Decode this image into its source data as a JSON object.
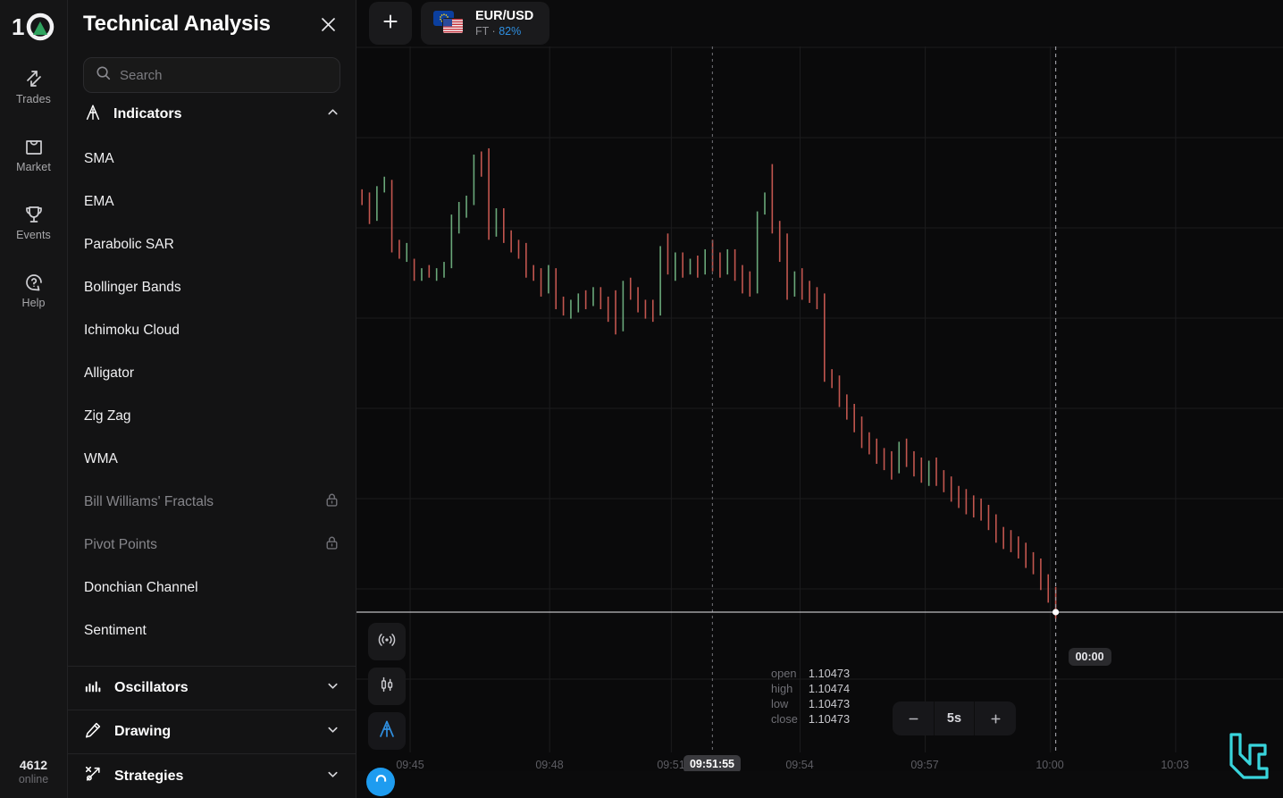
{
  "rail": {
    "logo": "1O-logo",
    "items": [
      {
        "label": "Trades",
        "icon": "trades-arrows-icon"
      },
      {
        "label": "Market",
        "icon": "market-bag-icon"
      },
      {
        "label": "Events",
        "icon": "events-trophy-icon"
      },
      {
        "label": "Help",
        "icon": "help-question-icon"
      }
    ],
    "online_count": "4612",
    "online_label": "online"
  },
  "panel": {
    "title": "Technical Analysis",
    "close_icon": "close-icon",
    "search": {
      "placeholder": "Search",
      "value": "",
      "icon": "search-icon"
    },
    "indicators_group": {
      "label": "Indicators",
      "icon": "indicators-icon",
      "expanded": true,
      "chevron": "chevron-up-icon",
      "items": [
        {
          "name": "SMA",
          "locked": false
        },
        {
          "name": "EMA",
          "locked": false
        },
        {
          "name": "Parabolic SAR",
          "locked": false
        },
        {
          "name": "Bollinger Bands",
          "locked": false
        },
        {
          "name": "Ichimoku Cloud",
          "locked": false
        },
        {
          "name": "Alligator",
          "locked": false
        },
        {
          "name": "Zig Zag",
          "locked": false
        },
        {
          "name": "WMA",
          "locked": false
        },
        {
          "name": "Bill Williams' Fractals",
          "locked": true
        },
        {
          "name": "Pivot Points",
          "locked": true
        },
        {
          "name": "Donchian Channel",
          "locked": false
        },
        {
          "name": "Sentiment",
          "locked": false
        }
      ]
    },
    "categories": [
      {
        "label": "Oscillators",
        "icon": "oscillators-bars-icon",
        "chevron": "chevron-down-icon"
      },
      {
        "label": "Drawing",
        "icon": "drawing-pencil-icon",
        "chevron": "chevron-down-icon"
      },
      {
        "label": "Strategies",
        "icon": "strategies-icon",
        "chevron": "chevron-down-icon"
      }
    ]
  },
  "topbar": {
    "add_label": "+",
    "add_icon": "plus-icon",
    "asset": {
      "name": "EUR/USD",
      "type": "FT",
      "separator": "·",
      "payout": "82%",
      "flag_left": "eu-flag-icon",
      "flag_right": "us-flag-icon"
    }
  },
  "chart": {
    "tools": [
      {
        "icon": "signal-broadcast-icon",
        "active": false
      },
      {
        "icon": "candlestick-chart-icon",
        "active": false
      },
      {
        "icon": "indicators-icon",
        "active": true
      }
    ],
    "ohlc": [
      {
        "key": "open",
        "value": "1.10473"
      },
      {
        "key": "high",
        "value": "1.10474"
      },
      {
        "key": "low",
        "value": "1.10473"
      },
      {
        "key": "close",
        "value": "1.10473"
      }
    ],
    "timeframe": {
      "minus": "−",
      "value": "5s",
      "plus": "+"
    },
    "countdown": "00:00",
    "current_time": "09:51:55",
    "time_labels": [
      "09:45",
      "09:48",
      "09:51",
      "09:54",
      "09:57",
      "10:00",
      "10:03"
    ],
    "watermark": "LC-logo"
  },
  "colors": {
    "bull": "#6aa87a",
    "bear": "#c2564f",
    "accent_blue": "#2f8fe0",
    "brand_green": "#2fa35f",
    "watermark_cyan": "#3ce0e8",
    "grid": "#1c1c1e",
    "background": "#0a0a0b"
  },
  "chart_data": {
    "type": "candlestick",
    "title": "EUR/USD",
    "xlabel": "",
    "ylabel": "",
    "interval": "5s",
    "grid": true,
    "x_ticks": [
      "09:45",
      "09:48",
      "09:51",
      "09:54",
      "09:57",
      "10:00",
      "10:03"
    ],
    "last_price": 1.10473,
    "ohlc_current": {
      "open": 1.10473,
      "high": 1.10474,
      "low": 1.10473,
      "close": 1.10473
    },
    "candles": [
      [
        1.1053,
        1.10532,
        1.10527,
        1.10529
      ],
      [
        1.10529,
        1.10531,
        1.10521,
        1.10523
      ],
      [
        1.10523,
        1.10533,
        1.10522,
        1.10532
      ],
      [
        1.10532,
        1.10536,
        1.10531,
        1.10534
      ],
      [
        1.10534,
        1.10535,
        1.10512,
        1.10514
      ],
      [
        1.10514,
        1.10516,
        1.1051,
        1.10512
      ],
      [
        1.10512,
        1.10515,
        1.10509,
        1.10514
      ],
      [
        1.10509,
        1.1051,
        1.10503,
        1.10505
      ],
      [
        1.10505,
        1.10507,
        1.10503,
        1.10506
      ],
      [
        1.10506,
        1.10508,
        1.10504,
        1.10505
      ],
      [
        1.10505,
        1.10507,
        1.10503,
        1.10506
      ],
      [
        1.10506,
        1.10509,
        1.10504,
        1.10508
      ],
      [
        1.10508,
        1.10524,
        1.10507,
        1.10522
      ],
      [
        1.10522,
        1.10528,
        1.10518,
        1.10526
      ],
      [
        1.10526,
        1.1053,
        1.10523,
        1.10528
      ],
      [
        1.10528,
        1.10543,
        1.10527,
        1.10541
      ],
      [
        1.10541,
        1.10544,
        1.10536,
        1.10539
      ],
      [
        1.10539,
        1.10545,
        1.10516,
        1.10519
      ],
      [
        1.10519,
        1.10526,
        1.10517,
        1.10524
      ],
      [
        1.10524,
        1.10526,
        1.10515,
        1.10517
      ],
      [
        1.10517,
        1.10519,
        1.10512,
        1.10514
      ],
      [
        1.10514,
        1.10516,
        1.1051,
        1.10513
      ],
      [
        1.10513,
        1.10515,
        1.10504,
        1.10506
      ],
      [
        1.10506,
        1.10508,
        1.10503,
        1.10505
      ],
      [
        1.10505,
        1.10507,
        1.10498,
        1.105
      ],
      [
        1.105,
        1.10508,
        1.10499,
        1.10506
      ],
      [
        1.10506,
        1.10507,
        1.10494,
        1.10496
      ],
      [
        1.10496,
        1.10498,
        1.10492,
        1.10494
      ],
      [
        1.10494,
        1.10497,
        1.10491,
        1.10495
      ],
      [
        1.10495,
        1.10499,
        1.10493,
        1.10497
      ],
      [
        1.10497,
        1.105,
        1.10494,
        1.10496
      ],
      [
        1.10496,
        1.10501,
        1.10495,
        1.10499
      ],
      [
        1.10499,
        1.10501,
        1.10494,
        1.10496
      ],
      [
        1.10496,
        1.10498,
        1.1049,
        1.10492
      ],
      [
        1.10492,
        1.105,
        1.10486,
        1.10488
      ],
      [
        1.10488,
        1.10503,
        1.10487,
        1.10501
      ],
      [
        1.10501,
        1.10504,
        1.10497,
        1.10499
      ],
      [
        1.10499,
        1.10501,
        1.10493,
        1.10495
      ],
      [
        1.10495,
        1.10497,
        1.10491,
        1.10494
      ],
      [
        1.10494,
        1.10497,
        1.1049,
        1.10493
      ],
      [
        1.10493,
        1.10514,
        1.10492,
        1.10512
      ],
      [
        1.10512,
        1.10518,
        1.10505,
        1.10508
      ],
      [
        1.10508,
        1.10512,
        1.10503,
        1.1051
      ],
      [
        1.1051,
        1.10512,
        1.10504,
        1.10506
      ],
      [
        1.10506,
        1.1051,
        1.10505,
        1.10508
      ],
      [
        1.10508,
        1.10511,
        1.10504,
        1.10506
      ],
      [
        1.10506,
        1.10513,
        1.10505,
        1.10511
      ],
      [
        1.10511,
        1.10516,
        1.10506,
        1.10509
      ],
      [
        1.10509,
        1.10512,
        1.10504,
        1.10507
      ],
      [
        1.10507,
        1.10513,
        1.10505,
        1.10511
      ],
      [
        1.10511,
        1.10513,
        1.10503,
        1.10505
      ],
      [
        1.10505,
        1.10508,
        1.10499,
        1.10502
      ],
      [
        1.10502,
        1.10506,
        1.10498,
        1.105
      ],
      [
        1.105,
        1.10525,
        1.10499,
        1.10523
      ],
      [
        1.10523,
        1.10531,
        1.10524,
        1.10529
      ],
      [
        1.10529,
        1.1054,
        1.10518,
        1.1052
      ],
      [
        1.1052,
        1.10522,
        1.10509,
        1.10511
      ],
      [
        1.10511,
        1.10518,
        1.10497,
        1.10499
      ],
      [
        1.10499,
        1.10506,
        1.10498,
        1.10504
      ],
      [
        1.10504,
        1.10507,
        1.10497,
        1.105
      ],
      [
        1.105,
        1.10503,
        1.10496,
        1.10498
      ],
      [
        1.10498,
        1.10501,
        1.10494,
        1.10497
      ],
      [
        1.10497,
        1.10499,
        1.10471,
        1.10473
      ],
      [
        1.10473,
        1.10475,
        1.10469,
        1.10471
      ],
      [
        1.10471,
        1.10473,
        1.10463,
        1.10465
      ],
      [
        1.10465,
        1.10467,
        1.10459,
        1.10461
      ],
      [
        1.10461,
        1.10464,
        1.10455,
        1.10458
      ],
      [
        1.10458,
        1.1046,
        1.1045,
        1.10452
      ],
      [
        1.10452,
        1.10455,
        1.10448,
        1.10451
      ],
      [
        1.10451,
        1.10453,
        1.10445,
        1.10447
      ],
      [
        1.10447,
        1.1045,
        1.10443,
        1.10446
      ],
      [
        1.10446,
        1.10449,
        1.1044,
        1.10443
      ],
      [
        1.10443,
        1.10452,
        1.10442,
        1.1045
      ],
      [
        1.1045,
        1.10453,
        1.10444,
        1.10446
      ],
      [
        1.10446,
        1.10449,
        1.10441,
        1.10444
      ],
      [
        1.10444,
        1.10447,
        1.10439,
        1.10442
      ],
      [
        1.10442,
        1.10446,
        1.10438,
        1.10444
      ],
      [
        1.10444,
        1.10447,
        1.10438,
        1.1044
      ],
      [
        1.1044,
        1.10443,
        1.10436,
        1.10439
      ],
      [
        1.10439,
        1.10441,
        1.10433,
        1.10435
      ],
      [
        1.10435,
        1.10438,
        1.10431,
        1.10434
      ],
      [
        1.10434,
        1.10437,
        1.10429,
        1.10432
      ],
      [
        1.10432,
        1.10435,
        1.10428,
        1.10431
      ],
      [
        1.10431,
        1.10434,
        1.10427,
        1.1043
      ],
      [
        1.1043,
        1.10432,
        1.10424,
        1.10426
      ],
      [
        1.10426,
        1.10429,
        1.1042,
        1.10422
      ],
      [
        1.10422,
        1.10425,
        1.10418,
        1.10421
      ],
      [
        1.10421,
        1.10424,
        1.10417,
        1.10419
      ],
      [
        1.10419,
        1.10422,
        1.10415,
        1.10418
      ],
      [
        1.10418,
        1.1042,
        1.10412,
        1.10414
      ],
      [
        1.10414,
        1.10417,
        1.1041,
        1.10413
      ],
      [
        1.10413,
        1.10415,
        1.10405,
        1.10407
      ],
      [
        1.10407,
        1.1041,
        1.10401,
        1.10403
      ],
      [
        1.10403,
        1.10406,
        1.10396,
        1.10398
      ]
    ]
  }
}
